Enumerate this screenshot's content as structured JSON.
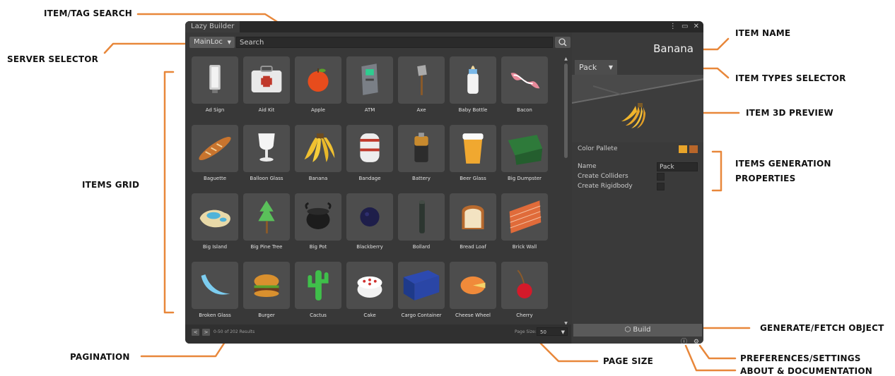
{
  "annotations": {
    "item_tag_search": "ITEM/TAG SEARCH",
    "server_selector": "SERVER SELECTOR",
    "items_grid": "ITEMS GRID",
    "pagination": "PAGINATION",
    "page_size": "PAGE SIZE",
    "item_name": "ITEM NAME",
    "item_types_selector": "ITEM TYPES SELECTOR",
    "item_3d_preview": "ITEM 3D PREVIEW",
    "items_generation_properties_1": "ITEMS GENERATION",
    "items_generation_properties_2": "PROPERTIES",
    "generate_fetch_object": "GENERATE/FETCH OBJECT",
    "preferences_settings": "PREFERENCES/SETTINGS",
    "about_documentation": "ABOUT & DOCUMENTATION"
  },
  "colors": {
    "accent": "#e8873a",
    "window_bg": "#383838",
    "panel_bg": "#3a3a3a"
  },
  "window": {
    "title": "Lazy Builder",
    "controls": [
      "⋮",
      "▭",
      "✕"
    ]
  },
  "search": {
    "server": "MainLoc",
    "placeholder": "Search",
    "icon": "search-icon"
  },
  "items": [
    {
      "label": "Ad Sign",
      "icon": "ad-sign"
    },
    {
      "label": "Aid Kit",
      "icon": "aid-kit"
    },
    {
      "label": "Apple",
      "icon": "apple"
    },
    {
      "label": "ATM",
      "icon": "atm"
    },
    {
      "label": "Axe",
      "icon": "axe"
    },
    {
      "label": "Baby Bottle",
      "icon": "baby-bottle"
    },
    {
      "label": "Bacon",
      "icon": "bacon"
    },
    {
      "label": "Baguette",
      "icon": "baguette"
    },
    {
      "label": "Balloon Glass",
      "icon": "balloon-glass"
    },
    {
      "label": "Banana",
      "icon": "banana"
    },
    {
      "label": "Bandage",
      "icon": "bandage"
    },
    {
      "label": "Battery",
      "icon": "battery"
    },
    {
      "label": "Beer Glass",
      "icon": "beer-glass"
    },
    {
      "label": "Big Dumpster",
      "icon": "big-dumpster"
    },
    {
      "label": "Big Island",
      "icon": "big-island"
    },
    {
      "label": "Big Pine Tree",
      "icon": "big-pine-tree"
    },
    {
      "label": "Big Pot",
      "icon": "big-pot"
    },
    {
      "label": "Blackberry",
      "icon": "blackberry"
    },
    {
      "label": "Bollard",
      "icon": "bollard"
    },
    {
      "label": "Bread Loaf",
      "icon": "bread-loaf"
    },
    {
      "label": "Brick Wall",
      "icon": "brick-wall"
    },
    {
      "label": "Broken Glass",
      "icon": "broken-glass"
    },
    {
      "label": "Burger",
      "icon": "burger"
    },
    {
      "label": "Cactus",
      "icon": "cactus"
    },
    {
      "label": "Cake",
      "icon": "cake"
    },
    {
      "label": "Cargo Container",
      "icon": "cargo-container"
    },
    {
      "label": "Cheese Wheel",
      "icon": "cheese-wheel"
    },
    {
      "label": "Cherry",
      "icon": "cherry"
    }
  ],
  "pagination": {
    "prev": "<",
    "next": ">",
    "results": "0-50 of 202 Results",
    "page_size_label": "Page Size:",
    "page_size": "50"
  },
  "details": {
    "item_name": "Banana",
    "type": "Pack",
    "color_palette_label": "Color Pallete",
    "color_swatches": [
      "#e8a42a",
      "#b8662a"
    ],
    "name_label": "Name",
    "name_value": "Pack",
    "create_colliders_label": "Create Colliders",
    "create_rigidbody_label": "Create Rigidbody",
    "create_colliders": false,
    "create_rigidbody": false,
    "build_label": "Build"
  }
}
